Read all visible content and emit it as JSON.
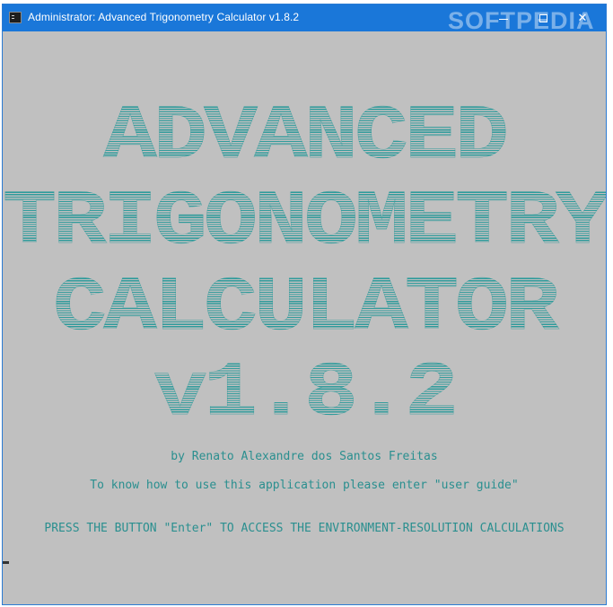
{
  "window": {
    "title": "Administrator:  Advanced Trigonometry Calculator v1.8.2",
    "watermark": "SOFTPEDIA",
    "controls": {
      "minimize_icon": "minimize-icon",
      "maximize_icon": "maximize-icon",
      "close_icon": "close-icon",
      "close_glyph": "✕"
    }
  },
  "console": {
    "banner": [
      "ADVANCED",
      "TRIGONOMETRY",
      "CALCULATOR",
      "v1.8.2"
    ],
    "author_line": "by Renato Alexandre dos Santos Freitas",
    "guide_line": "To know how to use this application please enter \"user guide\"",
    "press_line": "PRESS THE BUTTON \"Enter\" TO ACCESS THE ENVIRONMENT-RESOLUTION CALCULATIONS"
  },
  "colors": {
    "titlebar": "#1a77d9",
    "console_bg": "#c0c0c0",
    "text": "#2a8f8f"
  }
}
